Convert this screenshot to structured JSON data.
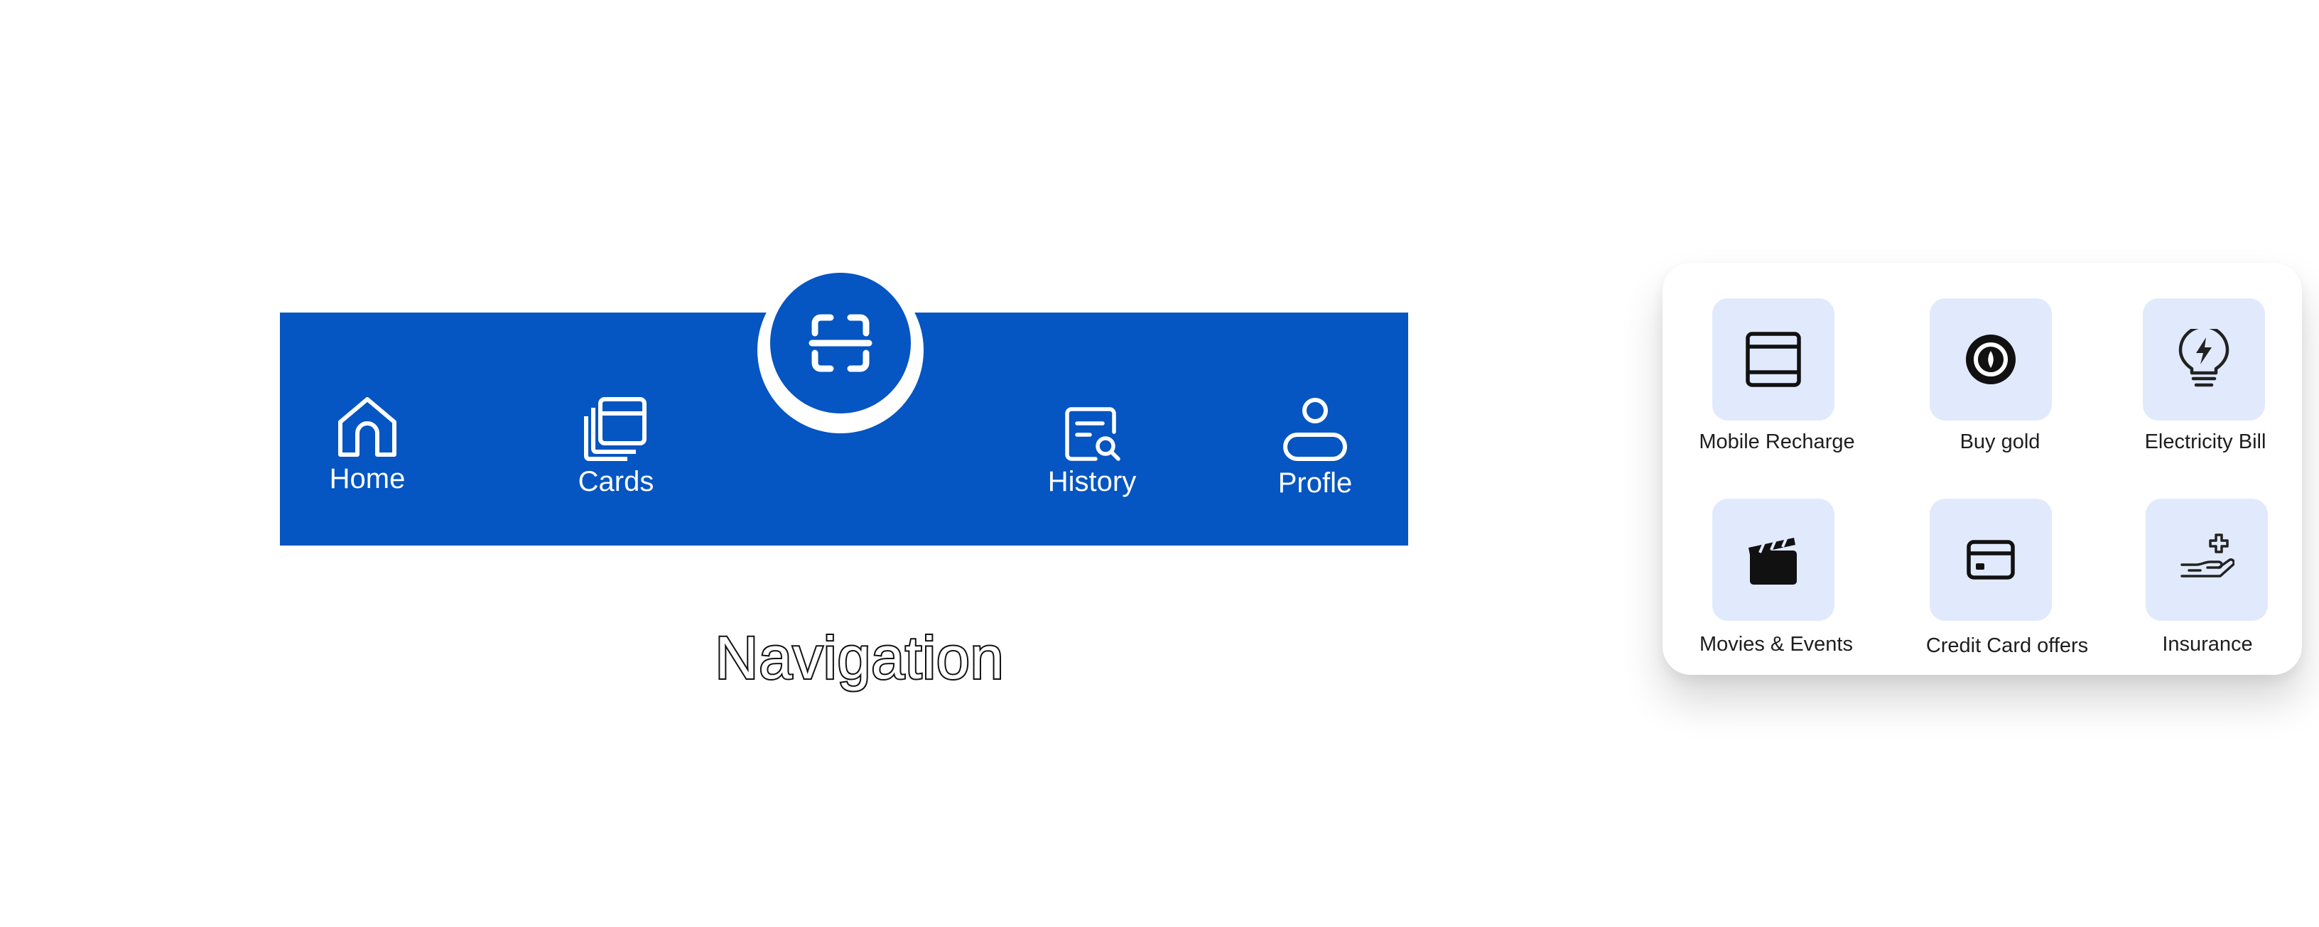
{
  "navigation": {
    "caption": "Navigation",
    "accent_color": "#0555c2",
    "items": [
      {
        "label": "Home",
        "icon": "home-icon"
      },
      {
        "label": "Cards",
        "icon": "cards-icon"
      },
      {
        "label": "History",
        "icon": "history-search-icon"
      },
      {
        "label": "Profle",
        "icon": "profile-icon"
      }
    ],
    "center_action": {
      "icon": "scan-qr-icon"
    }
  },
  "services": {
    "tile_color": "#e1eafc",
    "items": [
      {
        "label": "Mobile Recharge",
        "icon": "mobile-recharge-icon"
      },
      {
        "label": "Buy gold",
        "icon": "gold-coin-icon"
      },
      {
        "label": "Electricity Bill",
        "icon": "lightbulb-bolt-icon"
      },
      {
        "label": "Movies & Events",
        "icon": "clapperboard-icon"
      },
      {
        "label": "Credit Card offers",
        "icon": "credit-card-icon"
      },
      {
        "label": "Insurance",
        "icon": "insurance-hand-icon"
      }
    ]
  }
}
